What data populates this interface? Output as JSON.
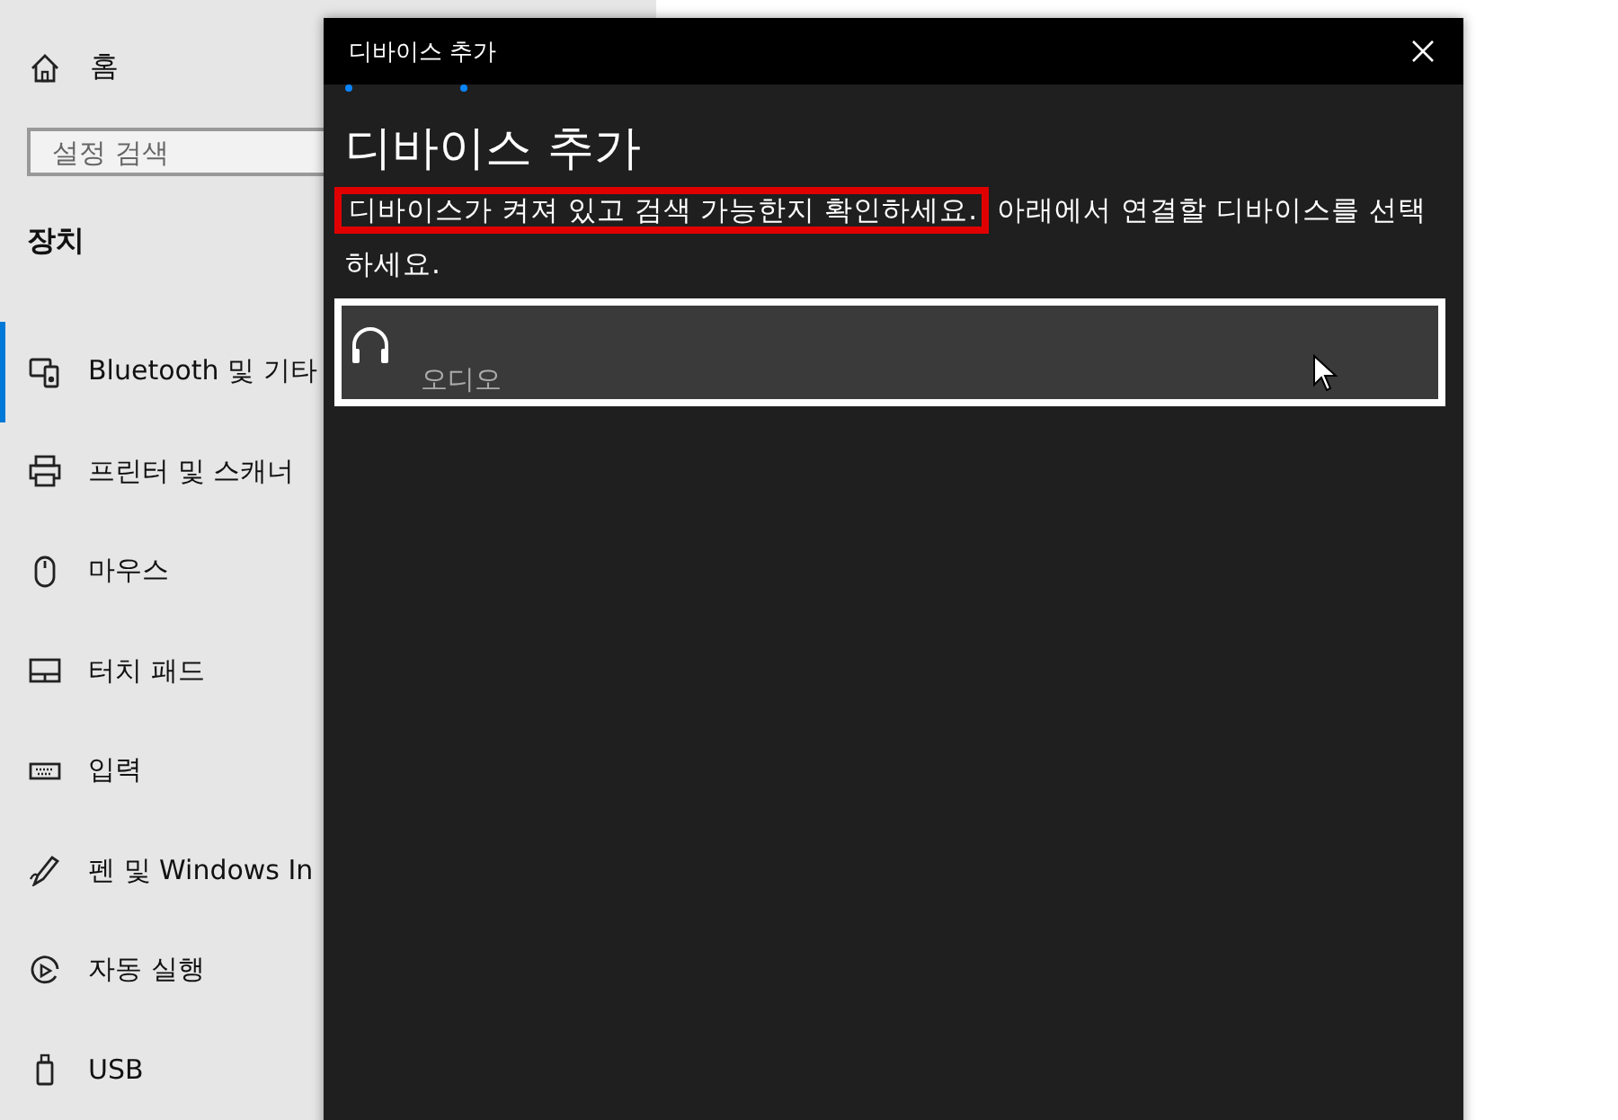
{
  "sidebar": {
    "home": {
      "label": "홈"
    },
    "search": {
      "placeholder": "설정 검색"
    },
    "section_title": "장치",
    "items": [
      {
        "kind": "bluetooth",
        "label": "Bluetooth 및 기타",
        "selected": true
      },
      {
        "kind": "printer",
        "label": "프린터 및 스캐너",
        "selected": false
      },
      {
        "kind": "mouse",
        "label": "마우스",
        "selected": false
      },
      {
        "kind": "touchpad",
        "label": "터치 패드",
        "selected": false
      },
      {
        "kind": "keyboard",
        "label": "입력",
        "selected": false
      },
      {
        "kind": "pen",
        "label": "펜 및 Windows In",
        "selected": false
      },
      {
        "kind": "autoplay",
        "label": "자동 실행",
        "selected": false
      },
      {
        "kind": "usb",
        "label": "USB",
        "selected": false
      }
    ]
  },
  "dialog": {
    "window_title": "디바이스 추가",
    "heading": "디바이스 추가",
    "instruction": {
      "highlighted": "디바이스가 켜져 있고 검색 가능한지 확인하세요.",
      "rest": " 아래에서 연결할 디바이스를 선택하세요."
    },
    "devices": [
      {
        "kind": "audio",
        "label": "오디오",
        "selected": true
      }
    ]
  }
}
